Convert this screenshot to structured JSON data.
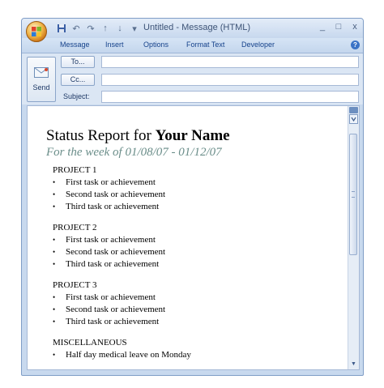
{
  "window": {
    "title": "Untitled - Message (HTML)",
    "controls": [
      "_",
      "□",
      "x"
    ]
  },
  "ribbon": {
    "tabs": [
      "Message",
      "Insert",
      "Options",
      "Format Text",
      "Developer"
    ],
    "help": "?"
  },
  "header": {
    "send_label": "Send",
    "to_label": "To...",
    "cc_label": "Cc...",
    "subject_label": "Subject:"
  },
  "document": {
    "title_plain": "Status Report for ",
    "title_bold": "Your Name",
    "subtitle": "For the week of 01/08/07 - 01/12/07",
    "sections": [
      {
        "heading": "PROJECT 1",
        "items": [
          "First task or achievement",
          "Second task or achievement",
          "Third task or achievement"
        ]
      },
      {
        "heading": "PROJECT 2",
        "items": [
          "First task or achievement",
          "Second task or achievement",
          "Third task or achievement"
        ]
      },
      {
        "heading": "PROJECT 3",
        "items": [
          "First task or achievement",
          "Second task or achievement",
          "Third task or achievement"
        ]
      },
      {
        "heading": "MISCELLANEOUS",
        "items": [
          "Half day medical leave on Monday"
        ]
      }
    ],
    "bullet": "•"
  },
  "colors": {
    "subtitle": "#6b8e8a",
    "tab_text": "#15428b",
    "chrome": "#c8d9ee"
  }
}
